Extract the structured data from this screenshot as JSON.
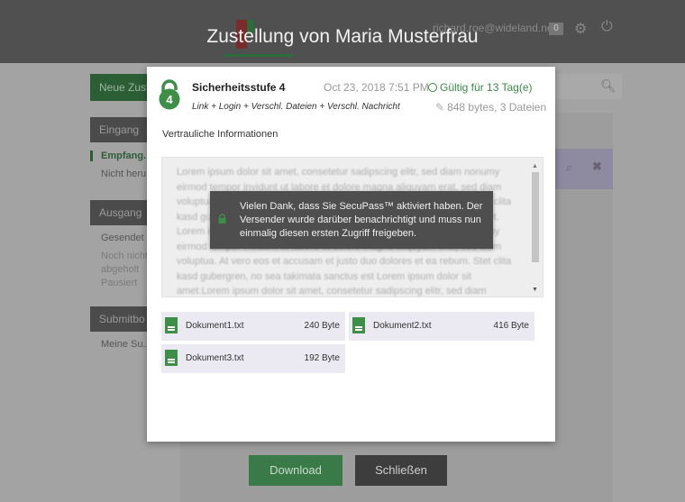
{
  "header": {
    "email": "richard.roe@wideland.net",
    "badge": "0"
  },
  "sidebar": {
    "new_button": "Neue Zust",
    "inbox_heading": "Eingang",
    "inbox_items": [
      "Empfang.",
      "Nicht heru"
    ],
    "outbox_heading": "Ausgang",
    "outbox_items": [
      "Gesendet",
      "Noch nicht",
      "abgeholt",
      "Pausiert"
    ],
    "submit_heading": "Submitbo",
    "submit_items": [
      "Meine Su..."
    ]
  },
  "footer": {
    "download_label": "Download",
    "close_label": "Schließen"
  },
  "modal": {
    "title": "Zustellung von Maria Musterfrau",
    "security_level_number": "4",
    "security_level": "Sicherheitsstufe 4",
    "date": "Oct 23, 2018 7:51 PM",
    "validity": "Gültig für 13 Tag(e)",
    "method": "Link + Login + Verschl. Dateien + Verschl. Nachricht",
    "size_info": "848 bytes, 3 Dateien",
    "subject": "Vertrauliche Informationen",
    "message_blurred": "Lorem ipsum dolor sit amet, consetetur sadipscing elitr, sed diam nonumy eirmod tempor invidunt ut labore et dolore magna aliquyam erat, sed diam voluptua. At vero eos et accusam et justo duo dolores et ea rebum. Stet clita kasd gubergren, no sea takimata sanctus est Lorem ipsum dolor sit amet. Lorem ipsum dolor sit amet, consetetur sadipscing elitr, sed diam nonumy eirmod tempor invidunt ut labore et dolore magna aliquyam erat, sed diam voluptua. At vero eos et accusam et justo duo dolores et ea rebum. Stet clita kasd gubergren, no sea takimata sanctus est Lorem ipsum dolor sit amet.Lorem ipsum dolor sit amet, consetetur sadipscing elitr, sed diam",
    "toast": "Vielen Dank, dass Sie SecuPass™ aktiviert haben. Der Versender wurde darüber benachrichtigt und muss nun einmalig diesen ersten Zugriff freigeben.",
    "files": [
      {
        "name": "Dokument1.txt",
        "size": "240 Byte"
      },
      {
        "name": "Dokument2.txt",
        "size": "416 Byte"
      },
      {
        "name": "Dokument3.txt",
        "size": "192 Byte"
      }
    ]
  },
  "colors": {
    "accent_green": "#3c8a46",
    "overlay_gray": "#a3a3a3",
    "file_tile": "#ebe9f2",
    "toast_bg": "#4e4e4e"
  }
}
